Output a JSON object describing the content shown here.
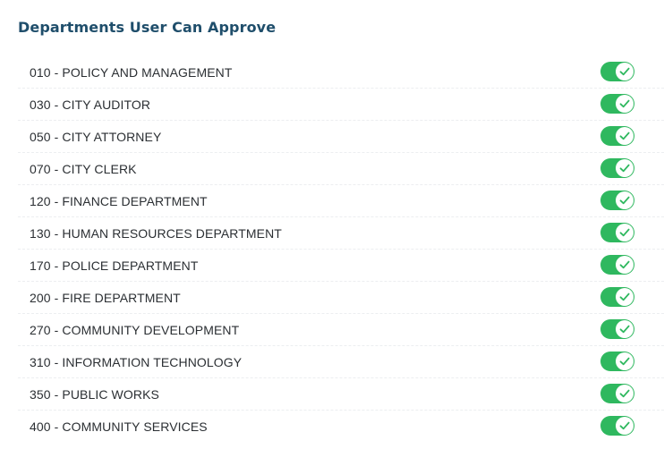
{
  "title": "Departments User Can Approve",
  "colors": {
    "title": "#1f4e6b",
    "toggle_on": "#2fb85f",
    "check": "#2fb85f"
  },
  "departments": [
    {
      "label": "010 - POLICY AND MANAGEMENT",
      "enabled": true
    },
    {
      "label": "030 - CITY AUDITOR",
      "enabled": true
    },
    {
      "label": "050 - CITY ATTORNEY",
      "enabled": true
    },
    {
      "label": "070 - CITY CLERK",
      "enabled": true
    },
    {
      "label": "120 - FINANCE DEPARTMENT",
      "enabled": true
    },
    {
      "label": "130 - HUMAN RESOURCES DEPARTMENT",
      "enabled": true
    },
    {
      "label": "170 - POLICE DEPARTMENT",
      "enabled": true
    },
    {
      "label": "200 - FIRE DEPARTMENT",
      "enabled": true
    },
    {
      "label": "270 - COMMUNITY DEVELOPMENT",
      "enabled": true
    },
    {
      "label": "310 - INFORMATION TECHNOLOGY",
      "enabled": true
    },
    {
      "label": "350 - PUBLIC WORKS",
      "enabled": true
    },
    {
      "label": "400 - COMMUNITY SERVICES",
      "enabled": true
    }
  ],
  "icons": {
    "toggle_knob": "check-icon"
  }
}
